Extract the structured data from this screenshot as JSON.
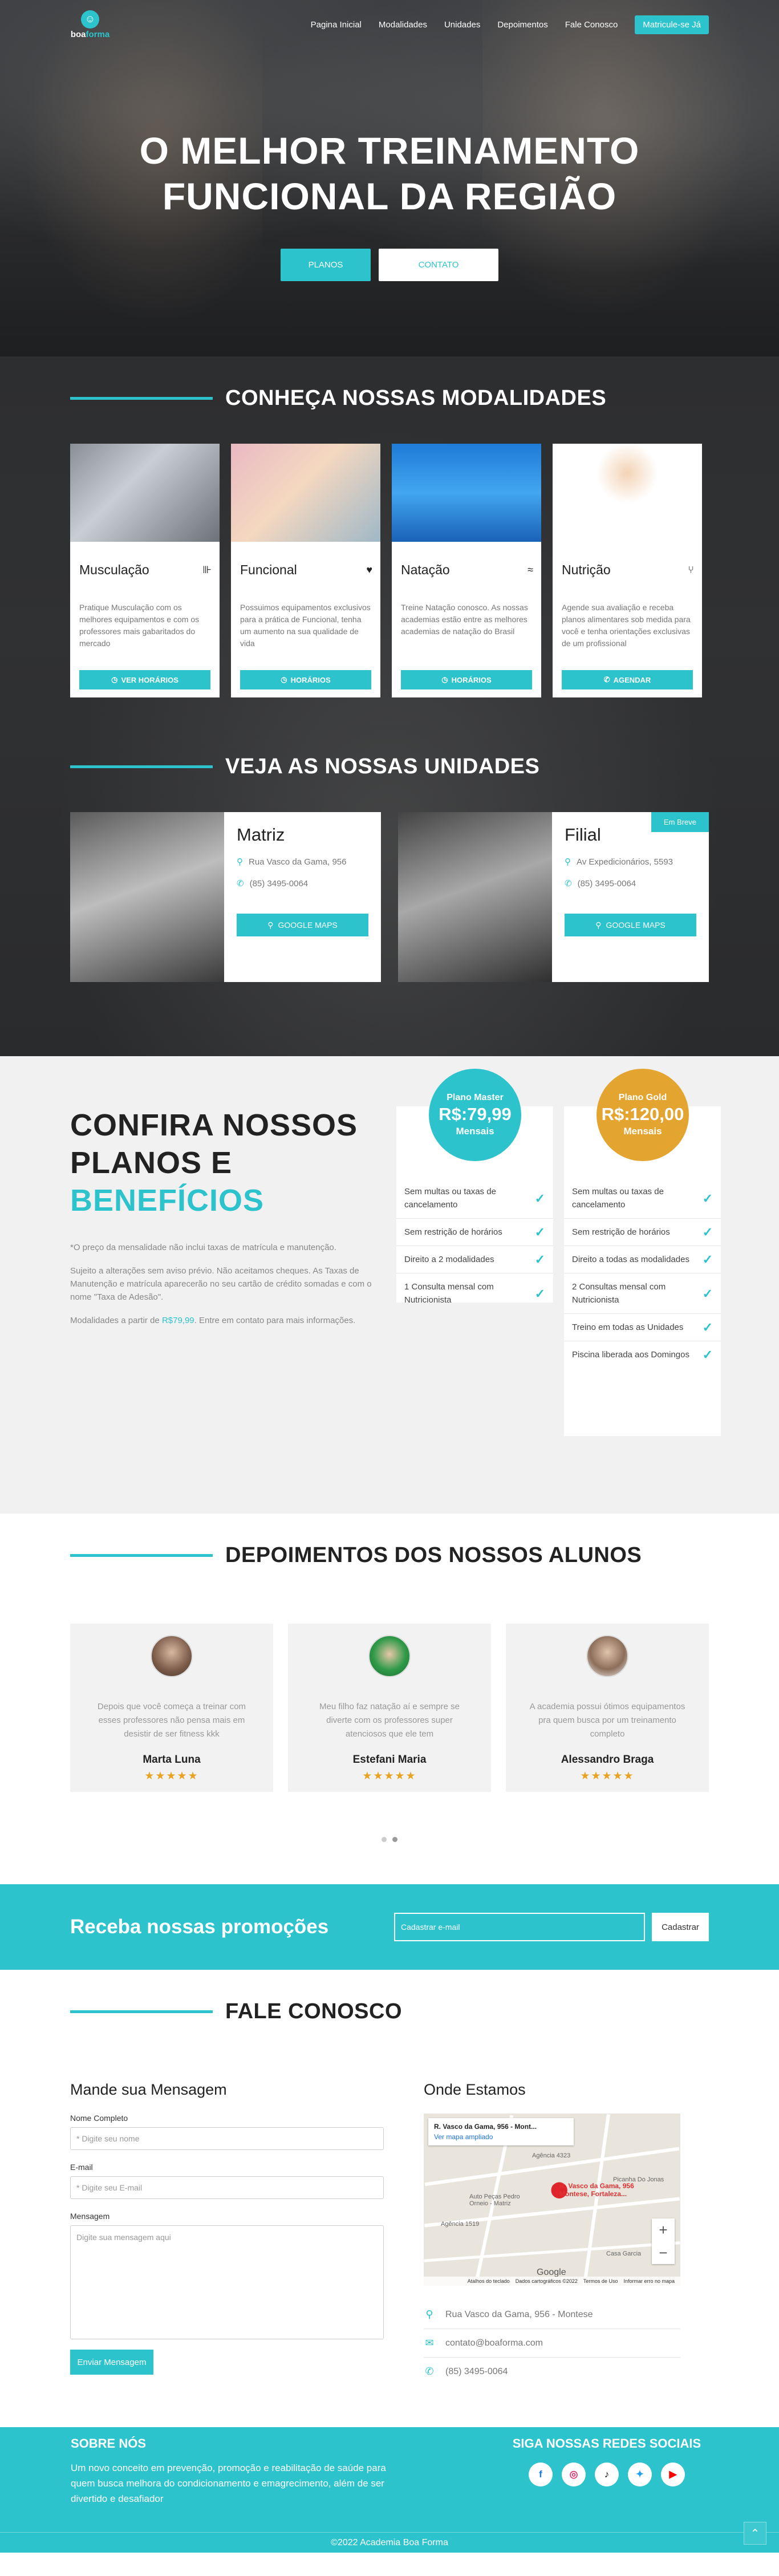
{
  "nav": {
    "logo": {
      "brand_a": "boa",
      "brand_b": "forma",
      "mark": "☺"
    },
    "links": [
      "Pagina Inicial",
      "Modalidades",
      "Unidades",
      "Depoimentos",
      "Fale Conosco"
    ],
    "cta": "Matricule-se Já"
  },
  "hero": {
    "title_line1": "O MELHOR TREINAMENTO",
    "title_line2": "FUNCIONAL DA REGIÃO",
    "btn_plans": "PLANOS",
    "btn_contact": "CONTATO"
  },
  "modalities": {
    "heading": "CONHEÇA NOSSAS MODALIDADES",
    "cards": [
      {
        "title": "Musculação",
        "icon": "dumbbell-icon",
        "glyph": "⊪",
        "text": "Pratique Musculação com os melhores equipamentos e com os professores mais gabaritados do mercado",
        "button": "VER HORÁRIOS"
      },
      {
        "title": "Funcional",
        "icon": "heartbeat-icon",
        "glyph": "♥",
        "text": "Possuimos equipamentos exclusivos para a prática de Funcional, tenha um aumento na sua qualidade de vida",
        "button": "HORÁRIOS"
      },
      {
        "title": "Natação",
        "icon": "swimmer-icon",
        "glyph": "≈",
        "text": "Treine Natação conosco. As nossas academias estão entre as melhores academias de natação do Brasil",
        "button": "HORÁRIOS"
      },
      {
        "title": "Nutrição",
        "icon": "utensils-icon",
        "glyph": "⑂",
        "text": "Agende sua avaliação e receba planos alimentares sob medida para você e tenha orientações exclusivas de um profissional",
        "button": "AGENDAR"
      }
    ]
  },
  "units": {
    "heading": "VEJA AS NOSSAS UNIDADES",
    "items": [
      {
        "title": "Matriz",
        "address": "Rua Vasco da Gama, 956",
        "phone": "(85) 3495-0064",
        "button": "GOOGLE MAPS",
        "badge": ""
      },
      {
        "title": "Filial",
        "address": "Av Expedicionários, 5593",
        "phone": "(85) 3495-0064",
        "button": "GOOGLE MAPS",
        "badge": "Em Breve"
      }
    ]
  },
  "plans": {
    "heading_line1": "CONFIRA NOSSOS",
    "heading_line2": "PLANOS E",
    "heading_line3": "BENEFÍCIOS",
    "note1": "*O preço da mensalidade não inclui taxas de matrícula e manutenção.",
    "note2": "Sujeito a alterações sem aviso prévio. Não aceitamos cheques. As Taxas de Manutenção e matrícula aparecerão no seu cartão de crédito somadas e com o nome \"Taxa de Adesão\".",
    "note3_a": "Modalidades a partir de ",
    "note3_price": "R$79,99",
    "note3_b": ". Entre em contato para mais informações.",
    "master": {
      "name": "Plano Master",
      "price": "R$:79,99",
      "period": "Mensais",
      "color": "#2cc3cc",
      "items": [
        "Sem multas ou taxas de cancelamento",
        "Sem restrição de horários",
        "Direito a 2 modalidades",
        "1 Consulta mensal com Nutricionista"
      ]
    },
    "gold": {
      "name": "Plano Gold",
      "price": "R$:120,00",
      "period": "Mensais",
      "color": "#e3a530",
      "items": [
        "Sem multas ou taxas de cancelamento",
        "Sem restrição de horários",
        "Direito a todas as modalidades",
        "2 Consultas mensal com Nutricionista",
        "Treino em todas as Unidades",
        "Piscina liberada aos Domingos"
      ]
    }
  },
  "testimonials": {
    "heading": "DEPOIMENTOS DOS NOSSOS ALUNOS",
    "items": [
      {
        "text": "Depois que você começa a treinar com esses professores não pensa mais em desistir de ser fitness kkk",
        "name": "Marta Luna",
        "stars": "★★★★★"
      },
      {
        "text": "Meu filho faz natação aí e sempre se diverte com os professores super atenciosos que ele tem",
        "name": "Estefani Maria",
        "stars": "★★★★★"
      },
      {
        "text": "A academia possui ótimos equipamentos pra quem busca por um treinamento completo",
        "name": "Alessandro Braga",
        "stars": "★★★★★"
      }
    ]
  },
  "promo": {
    "title": "Receba nossas promoções",
    "placeholder": "Cadastrar e-mail",
    "button": "Cadastrar"
  },
  "contact": {
    "heading": "FALE CONOSCO",
    "form_title": "Mande sua Mensagem",
    "name_label": "Nome Completo",
    "name_placeholder": "* Digite seu nome",
    "email_label": "E-mail",
    "email_placeholder": "* Digite seu E-mail",
    "message_label": "Mensagem",
    "message_placeholder": "Digite sua mensagem aqui",
    "submit": "Enviar Mensagem",
    "map_title": "Onde Estamos",
    "map": {
      "info_title": "R. Vasco da Gama, 956 - Mont...",
      "info_link": "Ver mapa ampliado",
      "pin_label_1": "R. Vasco da Gama, 956",
      "pin_label_2": "Montese, Fortaleza...",
      "labels": [
        "Agência 4323",
        "Picanha Do Jonas",
        "Auto Peças Pedro Orneio - Matriz",
        "Agência 1519",
        "Casa Garcia"
      ],
      "google": "Google",
      "attrib": [
        "Atalhos do teclado",
        "Dados cartográficos ©2022",
        "Termos de Uso",
        "Informar erro no mapa"
      ],
      "zoom_in": "+",
      "zoom_out": "−"
    },
    "address": "Rua Vasco da Gama, 956 - Montese",
    "email": "contato@boaforma.com",
    "phone": "(85) 3495-0064"
  },
  "footer": {
    "about_title": "SOBRE NÓS",
    "about_text": "Um novo conceito em prevenção, promoção e reabilitação de saúde para quem busca melhora do condicionamento e emagrecimento, além de ser divertido e desafiador",
    "social_title": "SIGA NOSSAS REDES SOCIAIS",
    "socials": [
      {
        "name": "facebook-icon",
        "glyph": "f",
        "color": "#1877f2"
      },
      {
        "name": "instagram-icon",
        "glyph": "◎",
        "color": "#e1306c"
      },
      {
        "name": "tiktok-icon",
        "glyph": "♪",
        "color": "#111111"
      },
      {
        "name": "twitter-icon",
        "glyph": "✦",
        "color": "#1da1f2"
      },
      {
        "name": "youtube-icon",
        "glyph": "▶",
        "color": "#ff0000"
      }
    ],
    "copyright": "©2022 Academia Boa Forma",
    "top_glyph": "⌃"
  }
}
